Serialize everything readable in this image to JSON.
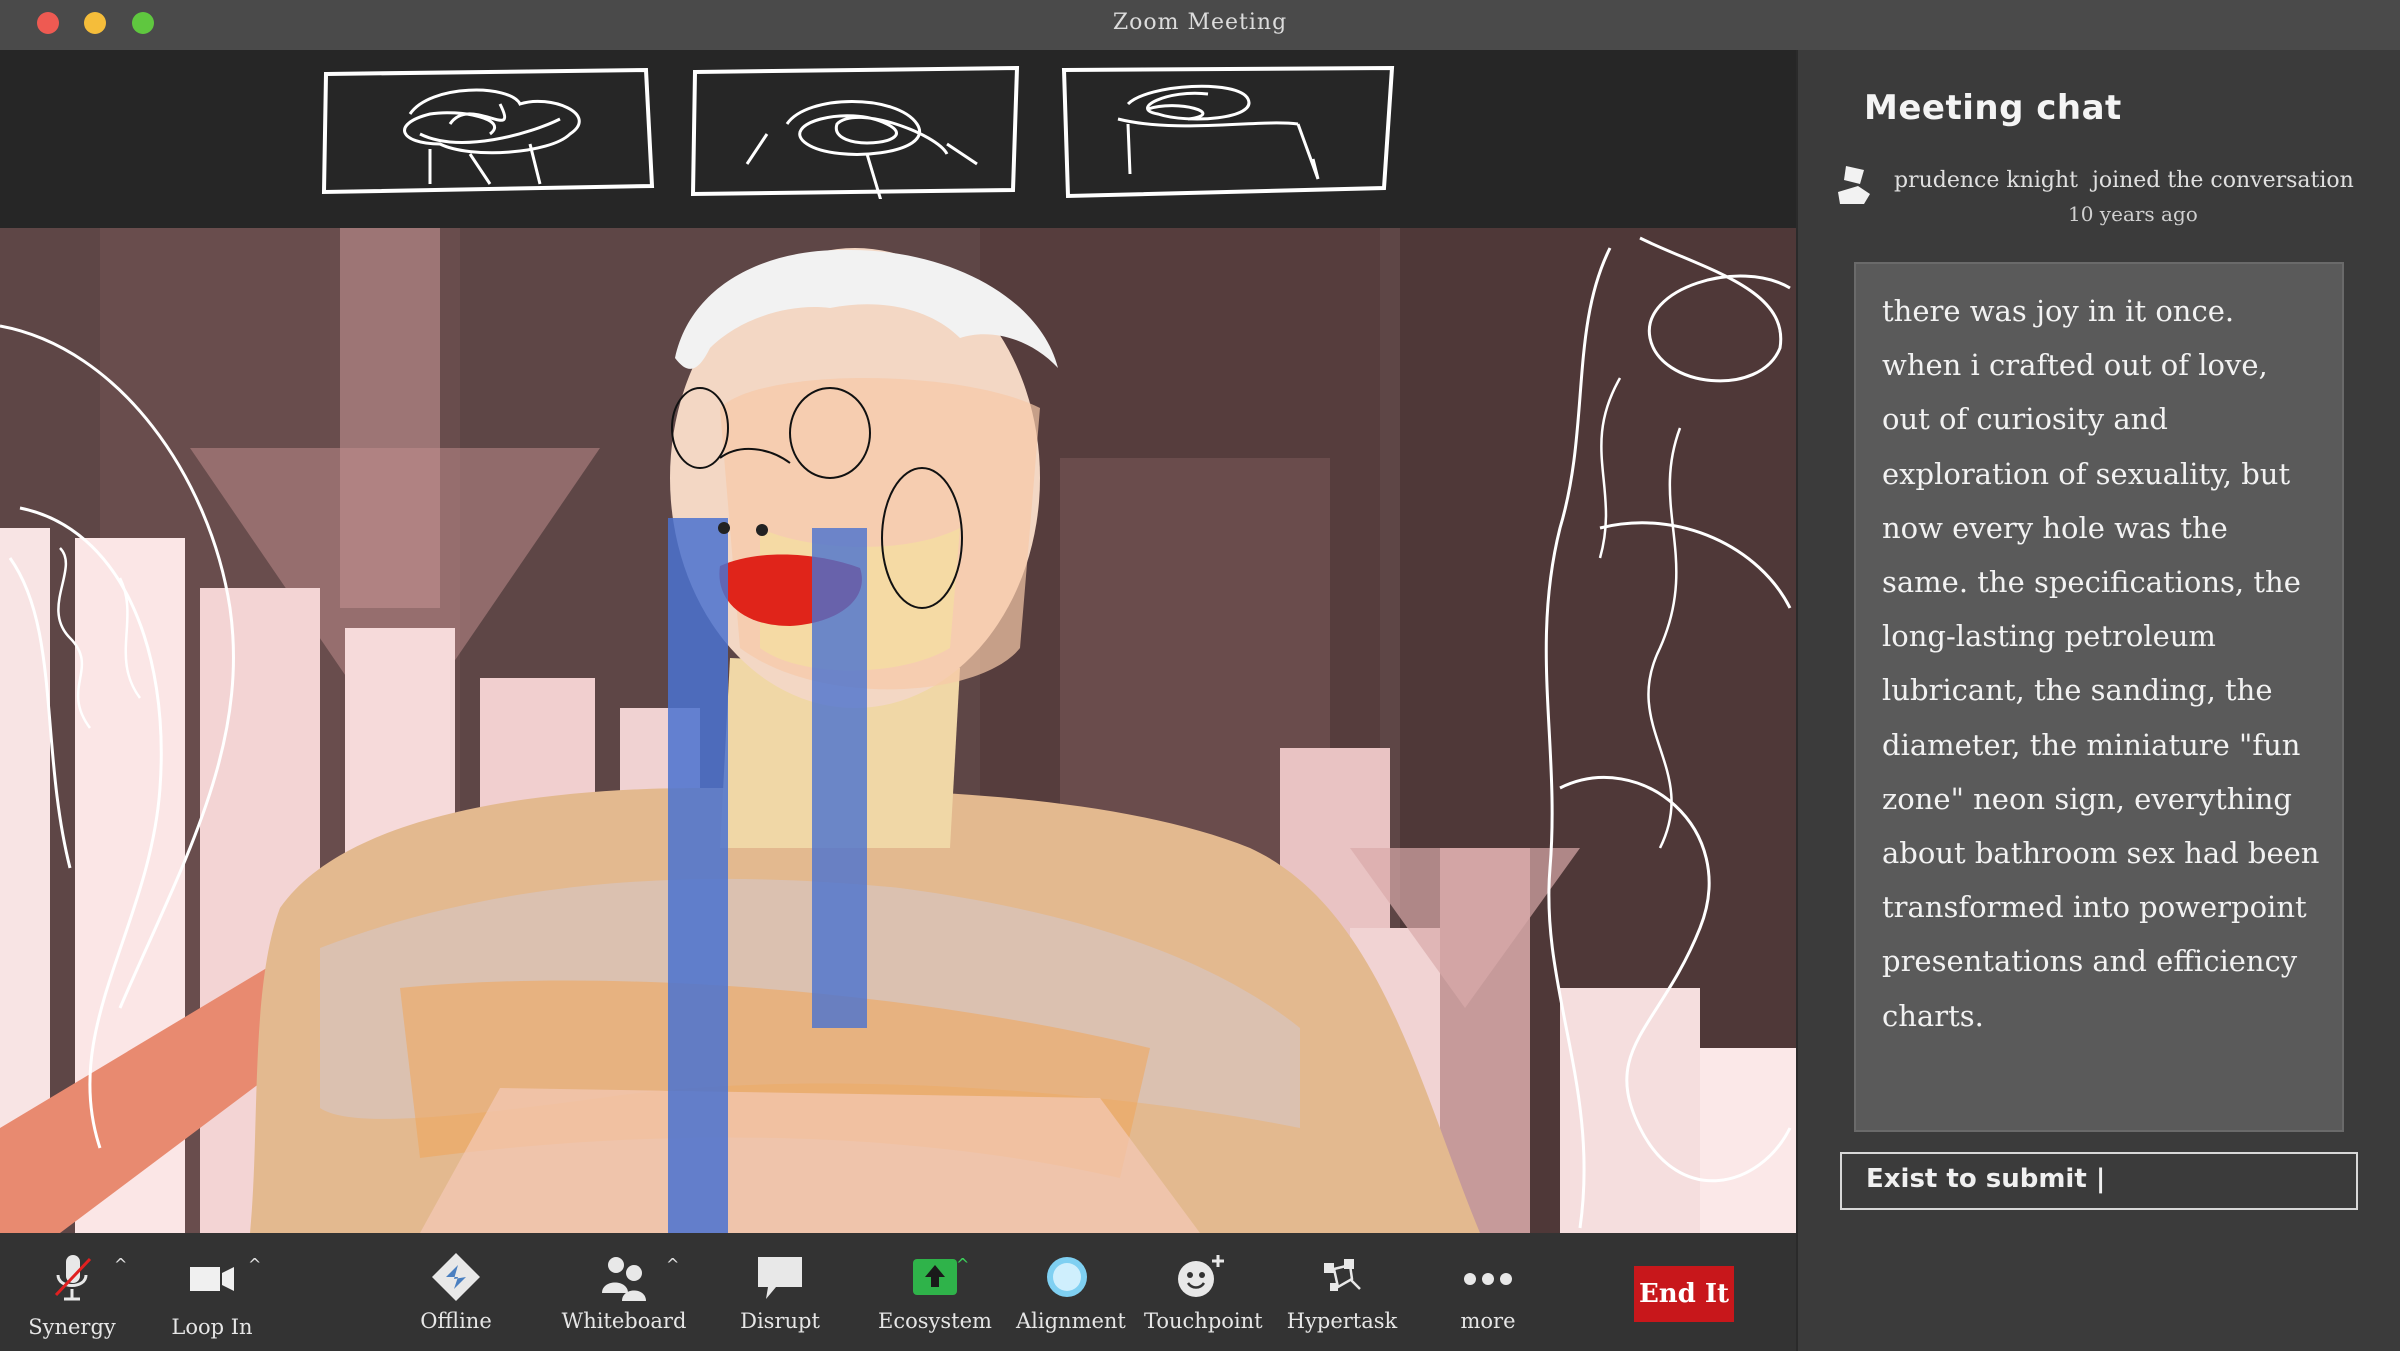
{
  "window": {
    "title": "Zoom Meeting"
  },
  "colors": {
    "end_button": "#c8171b",
    "chat_bg": "#3b3b3b",
    "message_bg": "#5a5a5a",
    "wall": "#5e4646"
  },
  "thumbnails": [
    {
      "icon": "scribble-thumbnail-icon"
    },
    {
      "icon": "scribble-thumbnail-icon"
    },
    {
      "icon": "scribble-thumbnail-icon"
    }
  ],
  "chat": {
    "title": "Meeting chat",
    "join": {
      "name": "prudence knight",
      "action": "joined the conversation",
      "time": "10 years ago"
    },
    "message_lines": [
      "there was joy in it once.",
      "when i crafted out of love,",
      "out of curiosity and",
      "exploration of sexuality, but",
      "now every hole was the",
      "same. the specifications, the",
      "long-lasting petroleum",
      "lubricant, the sanding, the",
      "diameter, the miniature \"fun",
      "zone\" neon sign, everything",
      "about bathroom sex had been",
      "transformed into powerpoint",
      "presentations and efficiency",
      "charts."
    ],
    "input_value": "Exist to submit |"
  },
  "toolbar": {
    "synergy": "Synergy",
    "loop_in": "Loop In",
    "offline": "Offline",
    "whiteboard": "Whiteboard",
    "disrupt": "Disrupt",
    "ecosystem": "Ecosystem",
    "alignment": "Alignment",
    "touchpoint": "Touchpoint",
    "hypertask": "Hypertask",
    "more": "more",
    "end": "End It",
    "caret": "^"
  }
}
